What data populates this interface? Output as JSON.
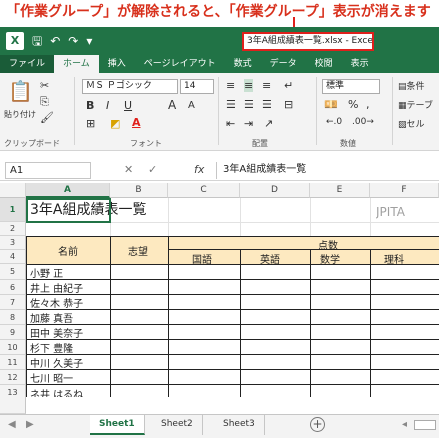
{
  "annotation": "「作業グループ」が解除されると、「作業グループ」表示が消えます",
  "titlebar": {
    "icons": [
      "excel-logo-icon",
      "save-icon",
      "undo-icon",
      "redo-icon",
      "customize-qat-icon"
    ],
    "title": "3年A組成績表一覧.xlsx - Excel"
  },
  "tabs": [
    "ファイル",
    "ホーム",
    "挿入",
    "ページレイアウト",
    "数式",
    "データ",
    "校閲",
    "表示"
  ],
  "ribbon": {
    "paste_label": "貼り付け",
    "font_name": "ＭＳ Ｐゴシック",
    "font_size": "14",
    "bold": "B",
    "italic": "I",
    "underline": "U",
    "grow_font": "A",
    "shrink_font": "A",
    "number_format": "標準",
    "percent": "%",
    "comma": ",",
    "conditional": "条件",
    "table": "テーブ",
    "cell_style": "セル",
    "groups": [
      "クリップボード",
      "フォント",
      "配置",
      "数値"
    ]
  },
  "formula_bar": {
    "name_box": "A1",
    "fx": "fx",
    "content": "3年A組成績表一覧"
  },
  "columns": [
    "A",
    "B",
    "C",
    "D",
    "E",
    "F"
  ],
  "rows": [
    "1",
    "2",
    "3",
    "4",
    "5",
    "6",
    "7",
    "8",
    "9",
    "10",
    "11",
    "12",
    "13"
  ],
  "sheet": {
    "title": "3年A組成績表一覧",
    "org": "JPITA",
    "header_name": "名前",
    "header_choice": "志望",
    "header_score": "点数",
    "subjects": [
      "国語",
      "英語",
      "数学",
      "理科"
    ],
    "names": [
      "小野 正",
      "井上 由紀子",
      "佐々木 恭子",
      "加藤 真吾",
      "田中 美奈子",
      "杉下 豊隆",
      "中川 久美子",
      "七川 昭一",
      "ネ井 はるね"
    ]
  },
  "sheet_tabs": [
    "Sheet1",
    "Sheet2",
    "Sheet3"
  ],
  "colors": {
    "excel_green": "#217346",
    "annotation_red": "#d8301c"
  }
}
